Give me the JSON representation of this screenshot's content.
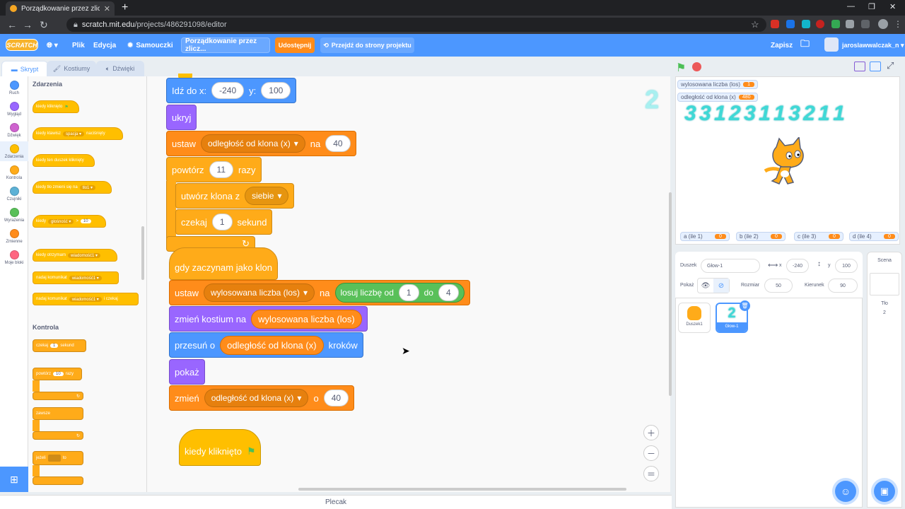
{
  "browser": {
    "tab_title": "Porządkowanie przez zliczanie or",
    "url_host": "scratch.mit.edu",
    "url_path": "/projects/486291098/editor"
  },
  "menu": {
    "logo": "SCRATCH",
    "file": "Plik",
    "edit": "Edycja",
    "tutorials": "Samouczki",
    "project_title": "Porządkowanie przez zlicz...",
    "share": "Udostępnij",
    "see_project": "Przejdź do strony projektu",
    "save": "Zapisz",
    "username": "jaroslawwalczak_n"
  },
  "editor_tabs": {
    "code": "Skrypt",
    "costumes": "Kostiumy",
    "sounds": "Dźwięki"
  },
  "categories": [
    {
      "label": "Ruch",
      "color": "#4c97ff"
    },
    {
      "label": "Wygląd",
      "color": "#9966ff"
    },
    {
      "label": "Dźwięk",
      "color": "#cf63cf"
    },
    {
      "label": "Zdarzenia",
      "color": "#ffbf00"
    },
    {
      "label": "Kontrola",
      "color": "#ffab19"
    },
    {
      "label": "Czujniki",
      "color": "#5cb1d6"
    },
    {
      "label": "Wyrażenia",
      "color": "#59c059"
    },
    {
      "label": "Zmienne",
      "color": "#ff8c1a"
    },
    {
      "label": "Moje bloki",
      "color": "#ff6680"
    }
  ],
  "palette": {
    "events_header": "Zdarzenia",
    "ev_flag": "kiedy kliknięto",
    "ev_key": "kiedy klawisz",
    "ev_key_dd": "spacja",
    "ev_key_tail": "naciśnięty",
    "ev_sprite": "kiedy ten duszek kliknięty",
    "ev_backdrop": "kiedy tło zmieni się na",
    "ev_backdrop_dd": "tło1",
    "ev_when": "kiedy",
    "ev_when_dd": "głośność",
    "ev_when_gt": ">",
    "ev_when_val": "10",
    "ev_receive": "kiedy otrzymam",
    "ev_receive_dd": "wiadomość1",
    "ev_broadcast": "nadaj komunikat",
    "ev_broadcast_dd": "wiadomość1",
    "ev_broadcastwait": "nadaj komunikat",
    "ev_broadcastwait_dd": "wiadomość1",
    "ev_broadcastwait_tail": "i czekaj",
    "control_header": "Kontrola",
    "ctl_wait": "czekaj",
    "ctl_wait_val": "1",
    "ctl_wait_tail": "sekund",
    "ctl_repeat": "powtórz",
    "ctl_repeat_val": "10",
    "ctl_repeat_tail": "razy",
    "ctl_forever": "zawsze",
    "ctl_if": "jeżeli",
    "ctl_if_tail": "to"
  },
  "script": {
    "goto": "Idź do x:",
    "goto_x": "-240",
    "goto_y_label": "y:",
    "goto_y": "100",
    "hide": "ukryj",
    "set1": "ustaw",
    "set1_var": "odległość od klona (x)",
    "set1_to": "na",
    "set1_val": "40",
    "repeat": "powtórz",
    "repeat_val": "11",
    "repeat_tail": "razy",
    "clone": "utwórz klona z",
    "clone_dd": "siebie",
    "wait": "czekaj",
    "wait_val": "1",
    "wait_tail": "sekund",
    "clone_start": "gdy zaczynam jako klon",
    "set2": "ustaw",
    "set2_var": "wylosowana liczba (los)",
    "set2_to": "na",
    "random": "losuj liczbę od",
    "random_from": "1",
    "random_to_label": "do",
    "random_to": "4",
    "costume": "zmień kostium na",
    "costume_rep": "wylosowana liczba (los)",
    "move": "przesuń o",
    "move_rep": "odległość od klona (x)",
    "move_tail": "kroków",
    "show": "pokaż",
    "change": "zmień",
    "change_var": "odległość od klona (x)",
    "change_by": "o",
    "change_val": "40",
    "flag_hat": "kiedy kliknięto",
    "sprite_preview": "2"
  },
  "stage": {
    "monitor1_label": "wylosowana liczba (los)",
    "monitor1_value": "1",
    "monitor2_label": "odległość od klona (x)",
    "monitor2_value": "480",
    "digits": "3 3 1 2 3 1 1 3 2 1 1",
    "list_monitors": [
      {
        "label": "a (ile 1)",
        "value": "0"
      },
      {
        "label": "b (ile 2)",
        "value": "0"
      },
      {
        "label": "c (ile 3)",
        "value": "0"
      },
      {
        "label": "d (ile 4)",
        "value": "0"
      }
    ]
  },
  "sprite_info": {
    "sprite_label": "Duszek",
    "sprite_name": "Głow-1",
    "x_label": "x",
    "x_value": "-240",
    "y_label": "y",
    "y_value": "100",
    "show_label": "Pokaż",
    "size_label": "Rozmiar",
    "size_value": "50",
    "direction_label": "Kierunek",
    "direction_value": "90",
    "sprites": [
      {
        "name": "Duszek1"
      },
      {
        "name": "Głow-1",
        "preview": "2"
      }
    ]
  },
  "stage_pane": {
    "title": "Scena",
    "backdrops_label": "Tło",
    "backdrops_count": "2"
  },
  "backpack": "Plecak"
}
